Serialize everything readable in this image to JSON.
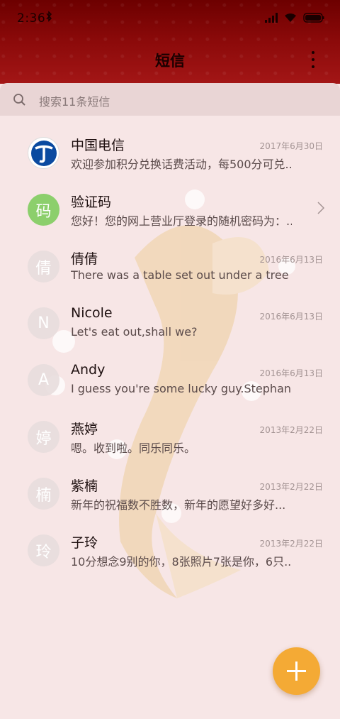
{
  "status_bar": {
    "time": "2:36",
    "bluetooth_icon": "bluetooth-icon",
    "signal_icon": "cell-signal-icon",
    "wifi_icon": "wifi-icon",
    "battery_icon": "battery-icon"
  },
  "header": {
    "title": "短信",
    "more_icon": "more-vertical-icon"
  },
  "search": {
    "placeholder": "搜索11条短信",
    "icon": "search-icon"
  },
  "conversations": [
    {
      "name": "中国电信",
      "avatar": "telecom-logo-icon",
      "preview": "欢迎参加积分兑换话费活动，每500分可兑...",
      "date": "2017年6月30日"
    },
    {
      "name": "验证码",
      "avatar": "码",
      "preview": "您好！您的网上营业厅登录的随机密码为：...",
      "date": ""
    },
    {
      "name": "倩倩",
      "avatar": "倩",
      "preview": "There was a table set out under a tree in...",
      "date": "2016年6月13日"
    },
    {
      "name": "Nicole",
      "avatar": "N",
      "preview": "Let's eat out,shall we?",
      "date": "2016年6月13日"
    },
    {
      "name": "Andy",
      "avatar": "A",
      "preview": "I guess you're some lucky guy.Stephani...",
      "date": "2016年6月13日"
    },
    {
      "name": "燕婷",
      "avatar": "婷",
      "preview": "嗯。收到啦。同乐同乐。",
      "date": "2013年2月22日"
    },
    {
      "name": "紫楠",
      "avatar": "楠",
      "preview": "新年的祝福数不胜数，新年的愿望好多好...",
      "date": "2013年2月22日"
    },
    {
      "name": "子玲",
      "avatar": "玲",
      "preview": "10分想念9别的你，8张照片7张是你，6只...",
      "date": "2013年2月22日"
    }
  ],
  "fab": {
    "icon": "plus-icon"
  },
  "colors": {
    "header": "#8c0a0a",
    "background": "#f7e6e6",
    "fab": "#f4aa35",
    "verification_avatar": "#8ccf6c"
  }
}
